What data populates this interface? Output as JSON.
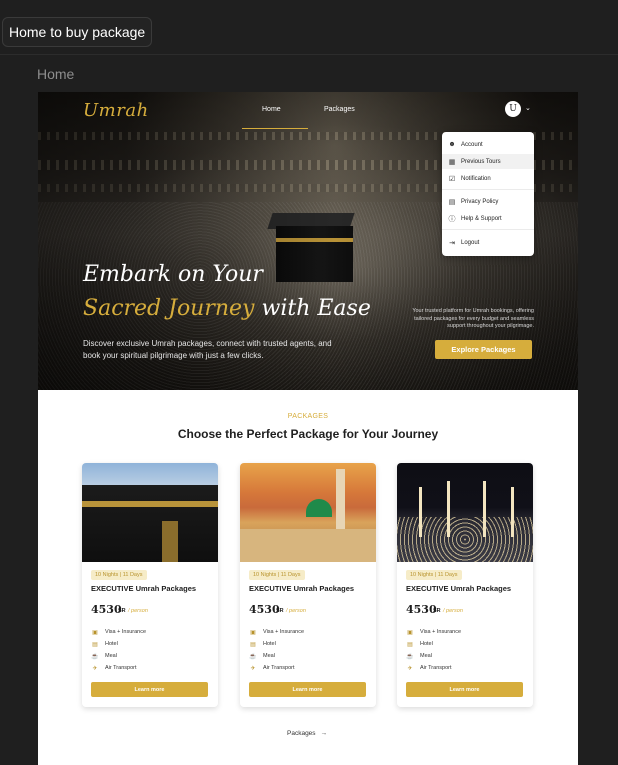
{
  "window": {
    "title": "Home to buy package"
  },
  "page": {
    "section_title": "Home"
  },
  "header": {
    "logo": "Umrah",
    "nav": [
      {
        "label": "Home",
        "active": true
      },
      {
        "label": "Packages",
        "active": false
      }
    ],
    "avatar_initial": "U"
  },
  "dropdown": {
    "items": [
      {
        "label": "Account",
        "icon": "user-icon"
      },
      {
        "label": "Previous Tours",
        "icon": "calendar-icon",
        "highlighted": true
      },
      {
        "label": "Notification",
        "icon": "check-square-icon"
      },
      {
        "label": "Privacy Policy",
        "icon": "shield-doc-icon"
      },
      {
        "label": "Help & Support",
        "icon": "question-circle-icon"
      },
      {
        "label": "Logout",
        "icon": "logout-icon"
      }
    ]
  },
  "hero": {
    "line1": "Embark on Your",
    "line2_accent": "Sacred Journey",
    "line2_rest": " with Ease",
    "description": "Discover exclusive Umrah packages, connect with trusted agents, and book your spiritual pilgrimage with just a few clicks.",
    "right_text": "Your trusted platform for Umrah bookings, offering tailored packages for every budget and seamless support throughout your pilgrimage.",
    "cta": "Explore Packages"
  },
  "packages": {
    "kicker": "PACKAGES",
    "title": "Choose the Perfect Package for Your Journey",
    "cards": [
      {
        "badge": "10 Nights | 11 Days",
        "name": "EXECUTIVE Umrah Packages",
        "price": "4530",
        "price_unit": "SR",
        "price_per": "/ person",
        "features": [
          "Visa + Insurance",
          "Hotel",
          "Meal",
          "Air Transport"
        ],
        "button": "Learn more"
      },
      {
        "badge": "10 Nights | 11 Days",
        "name": "EXECUTIVE Umrah Packages",
        "price": "4530",
        "price_unit": "SR",
        "price_per": "/ person",
        "features": [
          "Visa + Insurance",
          "Hotel",
          "Meal",
          "Air Transport"
        ],
        "button": "Learn more"
      },
      {
        "badge": "10 Nights | 11 Days",
        "name": "EXECUTIVE Umrah Packages",
        "price": "4530",
        "price_unit": "SR",
        "price_per": "/ person",
        "features": [
          "Visa + Insurance",
          "Hotel",
          "Meal",
          "Air Transport"
        ],
        "button": "Learn more"
      }
    ],
    "link": "Packages"
  },
  "colors": {
    "accent": "#d6ad3c",
    "background": "#1f1f1f",
    "canvas": "#ffffff"
  }
}
